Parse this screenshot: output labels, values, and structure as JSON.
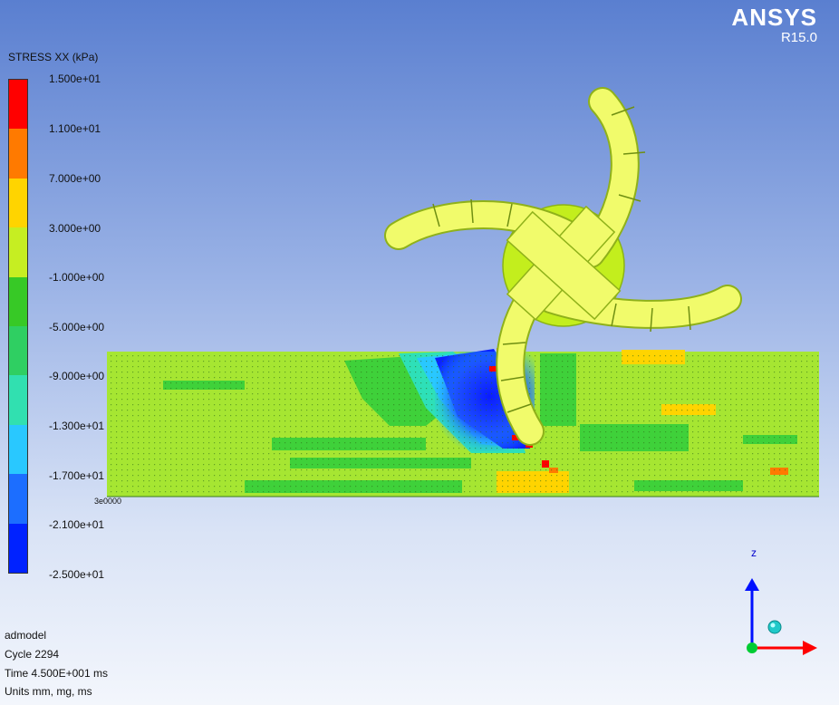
{
  "branding": {
    "name": "ANSYS",
    "version": "R15.0"
  },
  "legend": {
    "title": "STRESS XX (kPa)",
    "ticks": [
      "1.500e+01",
      "1.100e+01",
      "7.000e+00",
      "3.000e+00",
      "-1.000e+00",
      "-5.000e+00",
      "-9.000e+00",
      "-1.300e+01",
      "-1.700e+01",
      "-2.100e+01",
      "-2.500e+01"
    ],
    "colors": [
      "#ff0000",
      "#ff7a00",
      "#ffd400",
      "#c6ee22",
      "#37c926",
      "#2fcf62",
      "#31e0b0",
      "#29c8ff",
      "#1c6eff",
      "#0022ff"
    ]
  },
  "model_info": {
    "name": "admodel",
    "cycle": "Cycle 2294",
    "time": "Time 4.500E+001 ms",
    "units": "Units mm, mg, ms"
  },
  "axes": {
    "z_label": "z"
  },
  "mesh_origin_label": "3e0000"
}
